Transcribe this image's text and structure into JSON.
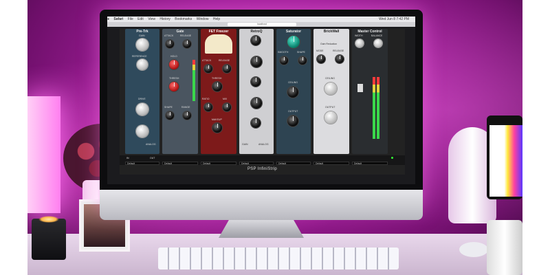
{
  "scene": {
    "description": "Photo of a desktop monitor displaying a channel-strip audio plugin",
    "colors": {
      "ambient": "#b0229f",
      "screen_bg": "#1b1b1e"
    }
  },
  "app": {
    "brand_prefix": "PSP InfiniStrip",
    "brand_suffix": "",
    "url": "localhost",
    "menu": [
      "Safari",
      "File",
      "Edit",
      "View",
      "History",
      "Bookmarks",
      "Window",
      "Help"
    ],
    "status_right": "Wed Jun 8 7:42 PM"
  },
  "strips": [
    {
      "title": "Pre-Trk",
      "color": "#2f4a5c",
      "labels": [
        "GAIN",
        "REFERENCE",
        "DRIVE",
        "ANALOG"
      ]
    },
    {
      "title": "Gate",
      "color": "#4a5560",
      "labels": [
        "ATTACK",
        "RELEASE",
        "HOLD",
        "THRESH",
        "SHAPE",
        "RANGE"
      ]
    },
    {
      "title": "FET Freezer",
      "color": "#7d1a1a",
      "labels": [
        "ATTACK",
        "RELEASE",
        "THRESH",
        "RATIO",
        "MIX",
        "MAKEUP"
      ]
    },
    {
      "title": "RetroQ",
      "color": "#cfcfd2",
      "labels": [
        "GAIN",
        "ANALOG"
      ]
    },
    {
      "title": "Saturator",
      "color": "#2e4452",
      "labels": [
        "SMOOTH",
        "SHAPE",
        "CEILING",
        "OUTPUT"
      ]
    },
    {
      "title": "BrickWall",
      "color": "#dcdcdf",
      "labels": [
        "Gain Reduction",
        "MODE",
        "RELEASE",
        "CEILING",
        "OUTPUT"
      ]
    },
    {
      "title": "Master Control",
      "color": "#2a2d30",
      "labels": [
        "WIDTH",
        "BALANCE"
      ]
    }
  ],
  "presets": [
    "Default",
    "Default",
    "Default",
    "Default",
    "Default",
    "Default",
    "Default"
  ],
  "io_labels": {
    "in": "IN",
    "out": "OUT"
  },
  "phone_status": "",
  "keyboard": "keyboard"
}
